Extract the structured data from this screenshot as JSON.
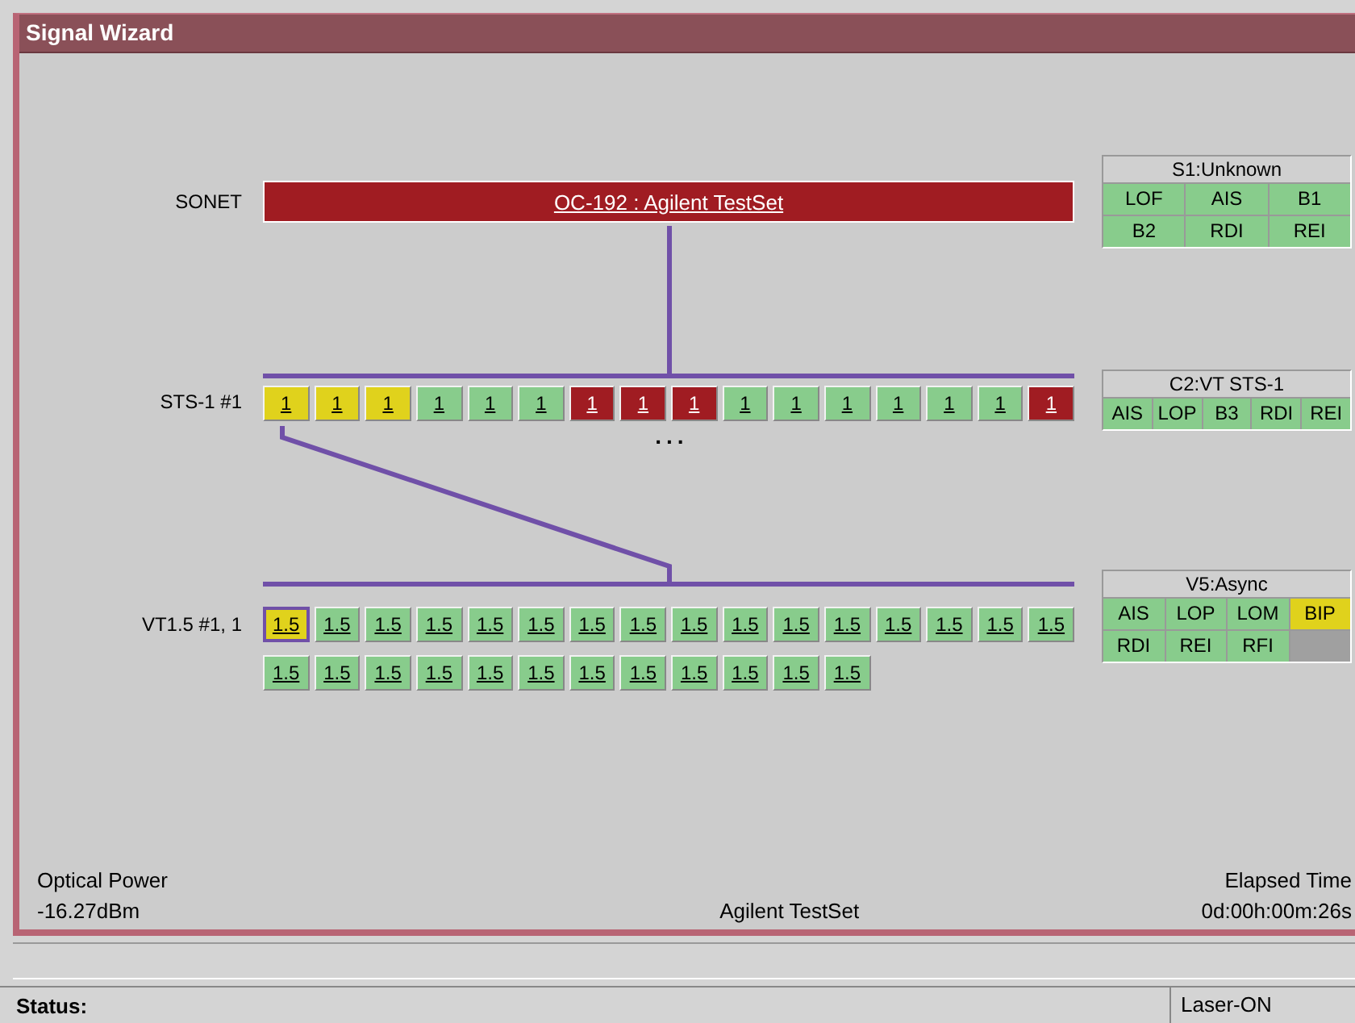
{
  "window": {
    "title": "Signal Wizard"
  },
  "sonet": {
    "label": "SONET",
    "link": "OC-192 : Agilent TestSet",
    "color": "#a01c22"
  },
  "sts": {
    "label": "STS-1 #1",
    "more": "...",
    "channels": [
      {
        "text": "1",
        "color": "#e0d21c"
      },
      {
        "text": "1",
        "color": "#e0d21c"
      },
      {
        "text": "1",
        "color": "#e0d21c"
      },
      {
        "text": "1",
        "color": "#88cc8c"
      },
      {
        "text": "1",
        "color": "#88cc8c"
      },
      {
        "text": "1",
        "color": "#88cc8c"
      },
      {
        "text": "1",
        "color": "#a01c22"
      },
      {
        "text": "1",
        "color": "#a01c22"
      },
      {
        "text": "1",
        "color": "#a01c22"
      },
      {
        "text": "1",
        "color": "#88cc8c"
      },
      {
        "text": "1",
        "color": "#88cc8c"
      },
      {
        "text": "1",
        "color": "#88cc8c"
      },
      {
        "text": "1",
        "color": "#88cc8c"
      },
      {
        "text": "1",
        "color": "#88cc8c"
      },
      {
        "text": "1",
        "color": "#88cc8c"
      },
      {
        "text": "1",
        "color": "#a01c22"
      }
    ]
  },
  "vt": {
    "label": "VT1.5 #1, 1",
    "channels": [
      {
        "text": "1.5",
        "color": "#e0d21c",
        "selected": true
      },
      {
        "text": "1.5",
        "color": "#88cc8c",
        "selected": false
      },
      {
        "text": "1.5",
        "color": "#88cc8c",
        "selected": false
      },
      {
        "text": "1.5",
        "color": "#88cc8c",
        "selected": false
      },
      {
        "text": "1.5",
        "color": "#88cc8c",
        "selected": false
      },
      {
        "text": "1.5",
        "color": "#88cc8c",
        "selected": false
      },
      {
        "text": "1.5",
        "color": "#88cc8c",
        "selected": false
      },
      {
        "text": "1.5",
        "color": "#88cc8c",
        "selected": false
      },
      {
        "text": "1.5",
        "color": "#88cc8c",
        "selected": false
      },
      {
        "text": "1.5",
        "color": "#88cc8c",
        "selected": false
      },
      {
        "text": "1.5",
        "color": "#88cc8c",
        "selected": false
      },
      {
        "text": "1.5",
        "color": "#88cc8c",
        "selected": false
      },
      {
        "text": "1.5",
        "color": "#88cc8c",
        "selected": false
      },
      {
        "text": "1.5",
        "color": "#88cc8c",
        "selected": false
      },
      {
        "text": "1.5",
        "color": "#88cc8c",
        "selected": false
      },
      {
        "text": "1.5",
        "color": "#88cc8c",
        "selected": false
      },
      {
        "text": "1.5",
        "color": "#88cc8c",
        "selected": false
      },
      {
        "text": "1.5",
        "color": "#88cc8c",
        "selected": false
      },
      {
        "text": "1.5",
        "color": "#88cc8c",
        "selected": false
      },
      {
        "text": "1.5",
        "color": "#88cc8c",
        "selected": false
      },
      {
        "text": "1.5",
        "color": "#88cc8c",
        "selected": false
      },
      {
        "text": "1.5",
        "color": "#88cc8c",
        "selected": false
      },
      {
        "text": "1.5",
        "color": "#88cc8c",
        "selected": false
      },
      {
        "text": "1.5",
        "color": "#88cc8c",
        "selected": false
      },
      {
        "text": "1.5",
        "color": "#88cc8c",
        "selected": false
      },
      {
        "text": "1.5",
        "color": "#88cc8c",
        "selected": false
      },
      {
        "text": "1.5",
        "color": "#88cc8c",
        "selected": false
      },
      {
        "text": "1.5",
        "color": "#88cc8c",
        "selected": false
      }
    ]
  },
  "panels": [
    {
      "title": "S1:Unknown",
      "rows": [
        [
          {
            "text": "LOF",
            "color": "#88cc8c"
          },
          {
            "text": "AIS",
            "color": "#88cc8c"
          },
          {
            "text": "B1",
            "color": "#88cc8c"
          }
        ],
        [
          {
            "text": "B2",
            "color": "#88cc8c"
          },
          {
            "text": "RDI",
            "color": "#88cc8c"
          },
          {
            "text": "REI",
            "color": "#88cc8c"
          }
        ]
      ]
    },
    {
      "title": "C2:VT STS-1",
      "rows": [
        [
          {
            "text": "AIS",
            "color": "#88cc8c"
          },
          {
            "text": "LOP",
            "color": "#88cc8c"
          },
          {
            "text": "B3",
            "color": "#88cc8c"
          },
          {
            "text": "RDI",
            "color": "#88cc8c"
          },
          {
            "text": "REI",
            "color": "#88cc8c"
          }
        ]
      ]
    },
    {
      "title": "V5:Async",
      "rows": [
        [
          {
            "text": "AIS",
            "color": "#88cc8c"
          },
          {
            "text": "LOP",
            "color": "#88cc8c"
          },
          {
            "text": "LOM",
            "color": "#88cc8c"
          },
          {
            "text": "BIP",
            "color": "#e0d21c"
          }
        ],
        [
          {
            "text": "RDI",
            "color": "#88cc8c"
          },
          {
            "text": "REI",
            "color": "#88cc8c"
          },
          {
            "text": "RFI",
            "color": "#88cc8c"
          }
        ]
      ]
    }
  ],
  "footer": {
    "power_label": "Optical Power",
    "power_value": "-16.27dBm",
    "device": "Agilent TestSet",
    "elapsed_label": "Elapsed Time",
    "elapsed_value": "0d:00h:00m:26s"
  },
  "status_bar": {
    "label": "Status:",
    "laser": "Laser-ON"
  }
}
